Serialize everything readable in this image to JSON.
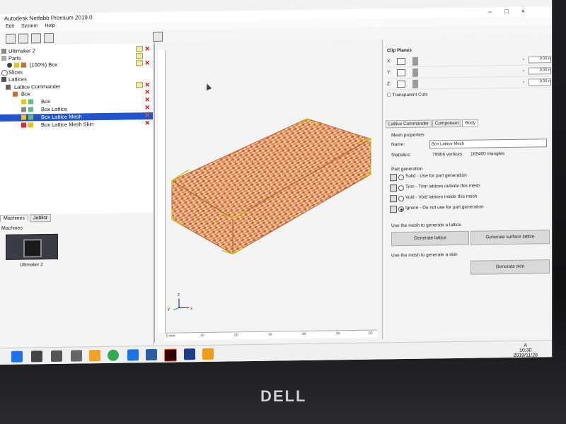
{
  "window": {
    "title": "Autodesk Netfabb Premium 2019.0"
  },
  "menu": [
    "Edit",
    "System",
    "Help"
  ],
  "tree": {
    "root": "Ultimaker 2",
    "parts_label": "Parts",
    "part_item": "(100%) Box",
    "slices_label": "Slices",
    "lattices_label": "Lattices",
    "lattice_commander": "Lattice Commander",
    "box_group": "Box",
    "items": [
      "Box",
      "Box Lattice",
      "Box Lattice Mesh",
      "Box Lattice Mesh Skin"
    ]
  },
  "lower_tabs": [
    "Machines",
    "Joblist"
  ],
  "machines_label": "Machines",
  "machine_name": "Ultimaker 2",
  "ruler_h": [
    "0 mm",
    "10",
    "20",
    "30",
    "40",
    "50",
    "60"
  ],
  "clip_planes": {
    "title": "Clip Planes",
    "rows": [
      {
        "axis": "X:",
        "value": "0.00 n"
      },
      {
        "axis": "Y:",
        "value": "0.00 n"
      },
      {
        "axis": "Z:",
        "value": "0.00 n"
      }
    ],
    "transparent_cuts": "Transparent Cuts"
  },
  "right_tabs": [
    "Lattice Commander",
    "Component",
    "Body"
  ],
  "mesh_properties": {
    "title": "Mesh properties",
    "name_label": "Name:",
    "name_value": "Box Lattice Mesh",
    "stats_label": "Statistics:",
    "vertices": "79906 vertices",
    "triangles": "165400 triangles"
  },
  "part_generation": {
    "title": "Part generation",
    "options": [
      "Solid - Use for part generation",
      "Trim - Trim lattices outside this mesh",
      "Void - Void lattices inside this mesh",
      "Ignore - Do not use for part generation"
    ],
    "selected_index": 3
  },
  "lattice_section": {
    "title": "Use the mesh to generate a lattice",
    "btn1": "Generate lattice",
    "btn2": "Generate surface lattice"
  },
  "skin_section": {
    "title": "Use the mesh to generate a skin",
    "btn": "Generate skin"
  },
  "taskbar": {
    "time": "10:30",
    "date": "2019/11/28",
    "ime": "A"
  },
  "bezel_brand": "DELL",
  "colors": {
    "lattice": "#e38b50",
    "selection": "#2255cc",
    "bbox": "#c8c820"
  }
}
